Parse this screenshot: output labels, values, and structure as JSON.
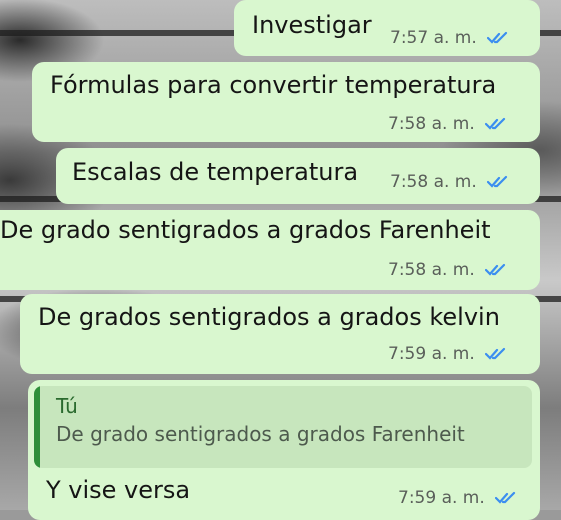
{
  "chat": {
    "messages": [
      {
        "text": "Investigar",
        "time": "7:57 a. m."
      },
      {
        "text": "Fórmulas para convertir temperatura",
        "time": "7:58 a. m."
      },
      {
        "text": "Escalas de temperatura",
        "time": "7:58 a. m."
      },
      {
        "text": "De grado sentigrados a grados Farenheit",
        "time": "7:58 a. m."
      },
      {
        "text": "De grados sentigrados a grados kelvin",
        "time": "7:59 a. m."
      },
      {
        "text": "Y vise versa",
        "time": "7:59 a. m.",
        "reply": {
          "author": "Tú",
          "text": "De grado sentigrados a grados Farenheit"
        }
      }
    ]
  },
  "colors": {
    "bubble": "#d9f7cf",
    "read_ticks": "#3b8ef0",
    "quote_bar": "#2f8f3a"
  },
  "icons": {
    "read_status": "double-check-icon"
  }
}
